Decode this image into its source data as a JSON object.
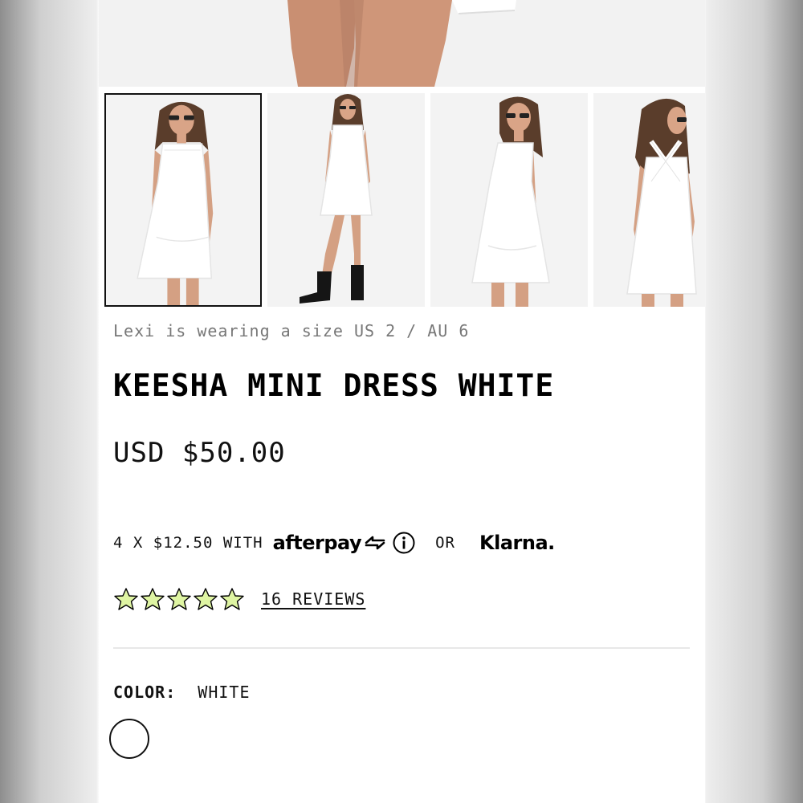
{
  "product": {
    "caption": "Lexi is wearing a size US 2 / AU 6",
    "title": "KEESHA MINI DRESS WHITE",
    "price": "USD $50.00"
  },
  "payment": {
    "installments_text": "4 X $12.50 WITH",
    "afterpay_brand": "afterpay",
    "or_text": "OR",
    "klarna_brand": "Klarna.",
    "icons": [
      "afterpay-arrows-icon",
      "info-icon"
    ]
  },
  "rating": {
    "stars": 5,
    "star_color": "#dff5a3",
    "reviews_label": "16 REVIEWS"
  },
  "color": {
    "label": "COLOR:",
    "value": "WHITE",
    "swatch_color": "#ffffff"
  },
  "gallery": {
    "thumbnail_count": 4,
    "selected_index": 0
  },
  "colors": {
    "accent_text": "#111111",
    "caption_text": "#777777"
  }
}
